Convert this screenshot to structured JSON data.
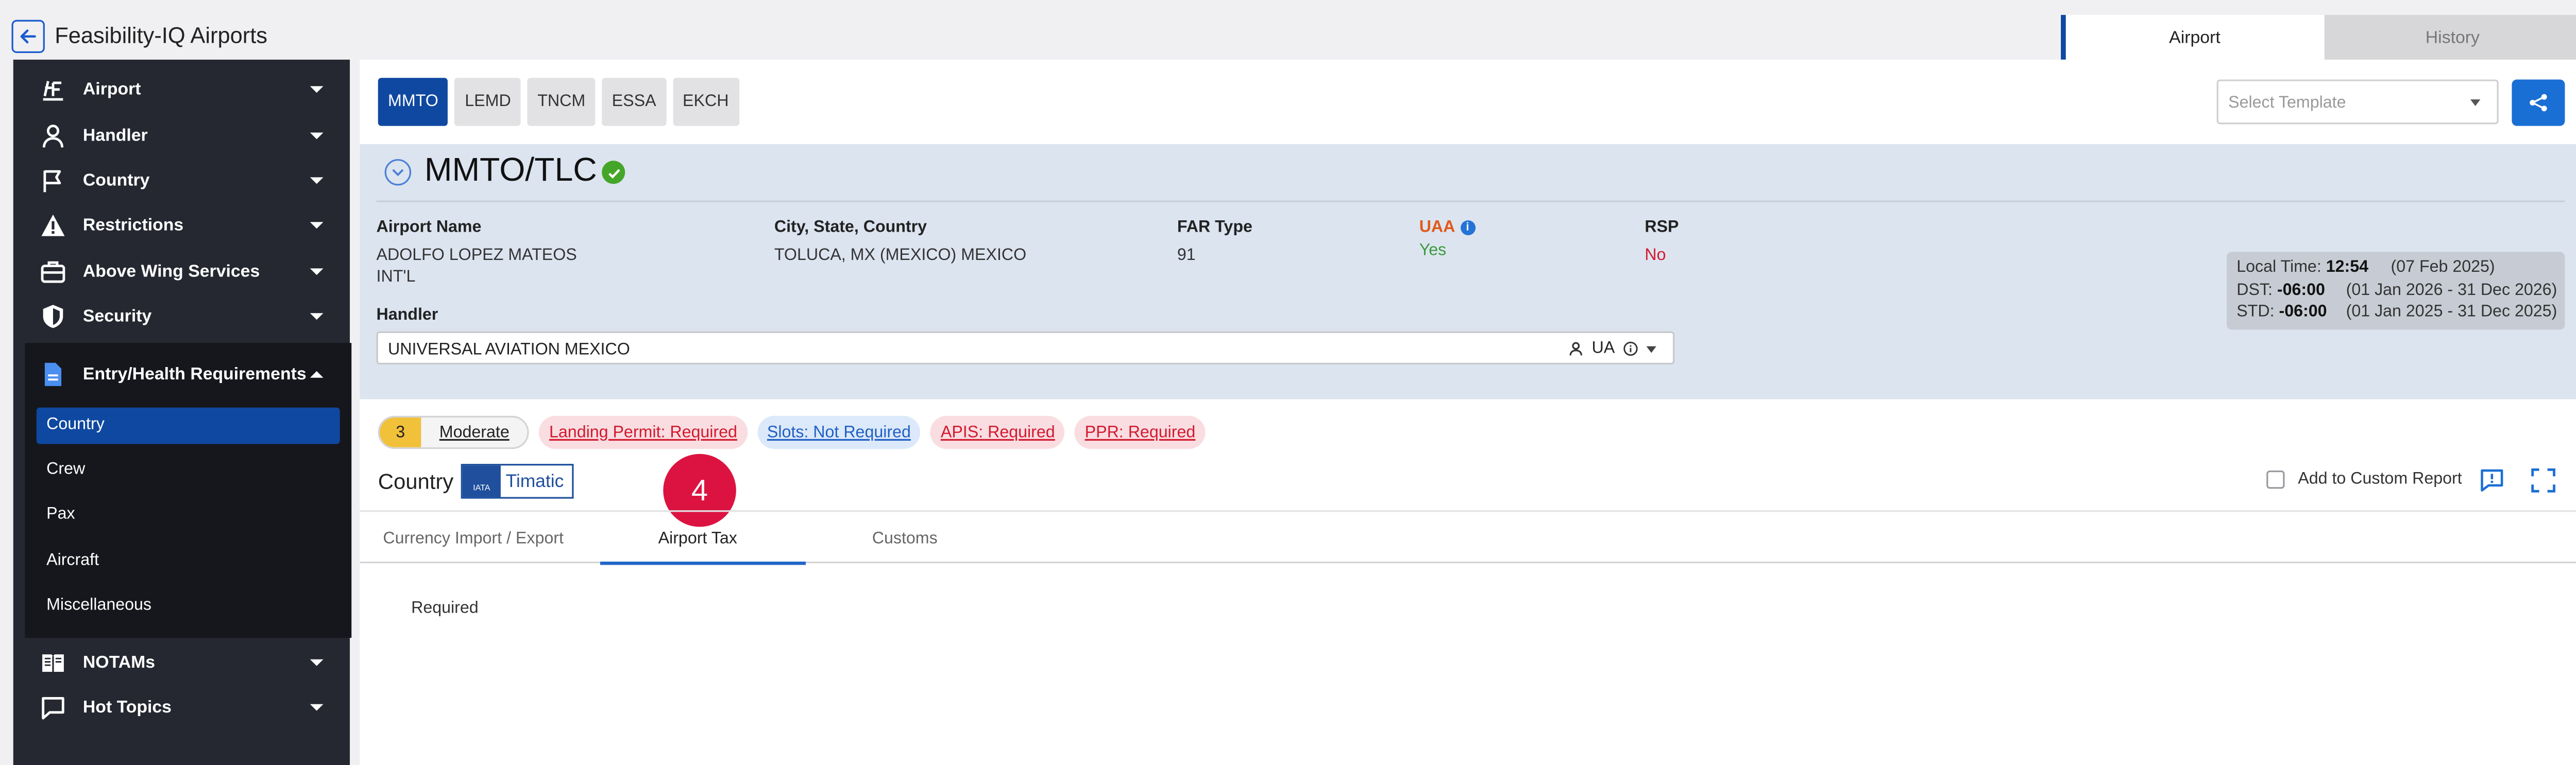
{
  "header": {
    "title": "Feasibility-IQ Airports",
    "tabs": [
      {
        "label": "Airport",
        "active": true
      },
      {
        "label": "History",
        "active": false
      }
    ]
  },
  "sidebar": {
    "items": [
      {
        "label": "Airport",
        "icon": "runway-icon"
      },
      {
        "label": "Handler",
        "icon": "user-icon"
      },
      {
        "label": "Country",
        "icon": "flag-icon"
      },
      {
        "label": "Restrictions",
        "icon": "warning-icon"
      },
      {
        "label": "Above Wing Services",
        "icon": "briefcase-icon"
      },
      {
        "label": "Security",
        "icon": "shield-icon"
      },
      {
        "label": "Entry/Health Requirements",
        "icon": "document-icon",
        "expanded": true
      },
      {
        "label": "NOTAMs",
        "icon": "book-icon"
      },
      {
        "label": "Hot Topics",
        "icon": "comment-icon"
      }
    ],
    "sub_items": [
      {
        "label": "Country",
        "active": true
      },
      {
        "label": "Crew"
      },
      {
        "label": "Pax"
      },
      {
        "label": "Aircraft"
      },
      {
        "label": "Miscellaneous"
      }
    ]
  },
  "content": {
    "airport_chips": [
      {
        "label": "MMTO",
        "active": true
      },
      {
        "label": "LEMD"
      },
      {
        "label": "TNCM"
      },
      {
        "label": "ESSA"
      },
      {
        "label": "EKCH"
      }
    ],
    "template_placeholder": "Select Template",
    "airport_code": "MMTO/TLC",
    "fields": {
      "airport_name_label": "Airport Name",
      "airport_name_line1": "ADOLFO LOPEZ MATEOS",
      "airport_name_line2": "INT'L",
      "city_label": "City, State, Country",
      "city_value": "TOLUCA, MX (MEXICO) MEXICO",
      "far_label": "FAR Type",
      "far_value": "91",
      "uaa_label": "UAA",
      "uaa_value": "Yes",
      "rsp_label": "RSP",
      "rsp_value": "No",
      "handler_label": "Handler",
      "handler_value": "UNIVERSAL AVIATION MEXICO",
      "handler_code": "UA"
    },
    "time": {
      "local_label": "Local Time:",
      "local_value": "12:54",
      "local_date": "(07 Feb 2025)",
      "dst_label": "DST:",
      "dst_value": "-06:00",
      "dst_range": "(01 Jan 2026 - 31 Dec 2026)",
      "std_label": "STD:",
      "std_value": "-06:00",
      "std_range": "(01 Jan 2025 - 31 Dec 2025)"
    },
    "risk": {
      "level": "3",
      "label": "Moderate"
    },
    "pills": [
      {
        "label": "Landing Permit: Required",
        "color": "red"
      },
      {
        "label": "Slots: Not Required",
        "color": "blue"
      },
      {
        "label": "APIS: Required",
        "color": "red"
      },
      {
        "label": "PPR: Required",
        "color": "red"
      }
    ],
    "section_title": "Country",
    "timatic": {
      "iata": "IATA",
      "name": "Timatic"
    },
    "step_number": "4",
    "custom_report_label": "Add to Custom Report",
    "tabs": [
      {
        "label": "Currency Import / Export"
      },
      {
        "label": "Airport Tax",
        "active": true
      },
      {
        "label": "Customs"
      }
    ],
    "tab_body": "Required"
  },
  "colors": {
    "primary": "#0f48a0",
    "accent_blue": "#1a6fd4",
    "sidebar_bg": "#252830",
    "risk_yellow": "#f2c13a",
    "danger_red": "#d3192f",
    "step_red": "#dc1341",
    "success_green": "#44a629"
  }
}
